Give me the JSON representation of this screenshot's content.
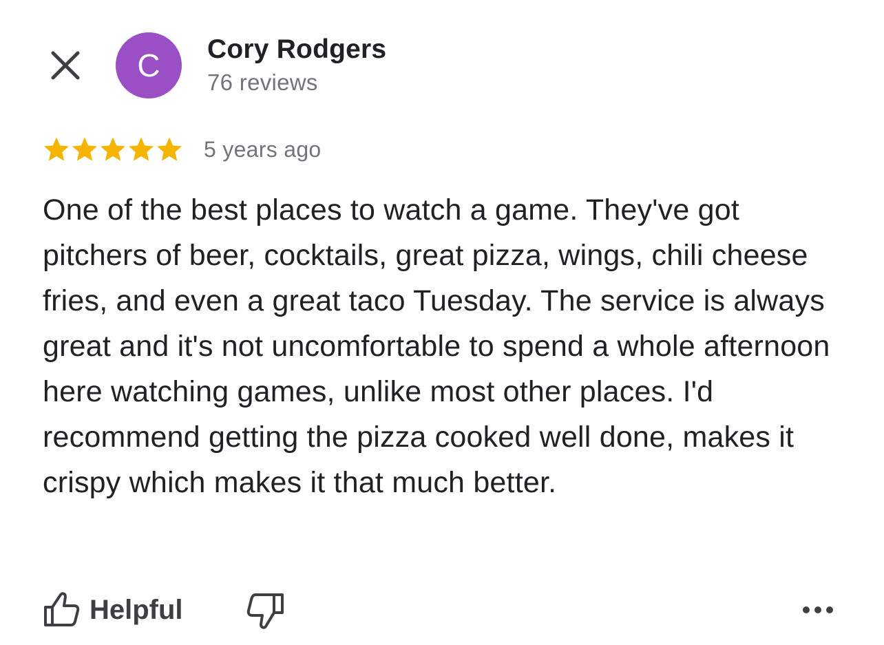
{
  "author": {
    "name": "Cory Rodgers",
    "avatar_initial": "C",
    "avatar_color": "#9b4fc4",
    "review_count": "76 reviews"
  },
  "review": {
    "rating": 5,
    "max_rating": 5,
    "star_color": "#f4b400",
    "time_ago": "5 years ago",
    "text": "One of the best places to watch a game. They've got pitchers of beer, cocktails, great pizza, wings, chili cheese fries, and even a great taco Tuesday. The service is always great and it's not uncomfortable to spend a whole afternoon here watching games, unlike most other places. I'd recommend getting the pizza cooked well done, makes it crispy which makes it that much better."
  },
  "actions": {
    "helpful_label": "Helpful",
    "close_icon": "close-icon",
    "thumbs_up_icon": "thumbs-up-icon",
    "thumbs_down_icon": "thumbs-down-icon",
    "more_icon": "more-horizontal-icon"
  }
}
